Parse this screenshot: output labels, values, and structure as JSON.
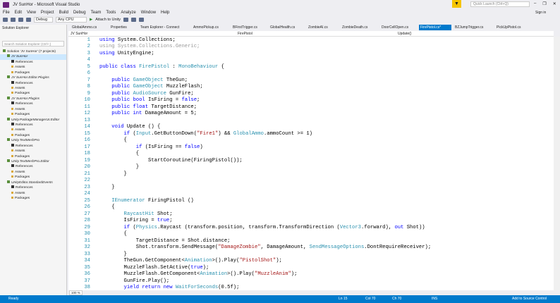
{
  "title": "JV SunHor - Microsoft Visual Studio",
  "menu": [
    "File",
    "Edit",
    "View",
    "Project",
    "Build",
    "Debug",
    "Team",
    "Tools",
    "Analyze",
    "Window",
    "Help"
  ],
  "toolbar": {
    "config": "Debug",
    "platform": "Any CPU",
    "attach": "Attach to Unity"
  },
  "quick_launch": "Quick Launch (Ctrl+Q)",
  "sign_in": "Sign in",
  "solution_explorer": {
    "title": "Solution Explorer",
    "search_placeholder": "Search Solution Explorer (Ctrl+;)",
    "items": [
      {
        "label": "Solution 'JV SunHor' (7 projects)",
        "level": 0,
        "type": "solution"
      },
      {
        "label": "JV SunHor",
        "level": 1,
        "type": "project",
        "selected": true
      },
      {
        "label": "References",
        "level": 2,
        "type": "ref"
      },
      {
        "label": "Assets",
        "level": 2,
        "type": "folder"
      },
      {
        "label": "Packages",
        "level": 2,
        "type": "folder"
      },
      {
        "label": "JV SunHor.Editor.Plugins",
        "level": 1,
        "type": "project"
      },
      {
        "label": "References",
        "level": 2,
        "type": "ref"
      },
      {
        "label": "Assets",
        "level": 2,
        "type": "folder"
      },
      {
        "label": "Packages",
        "level": 2,
        "type": "folder"
      },
      {
        "label": "JV SunHor.Plugins",
        "level": 1,
        "type": "project"
      },
      {
        "label": "References",
        "level": 2,
        "type": "ref"
      },
      {
        "label": "Assets",
        "level": 2,
        "type": "folder"
      },
      {
        "label": "Packages",
        "level": 2,
        "type": "folder"
      },
      {
        "label": "Unity.PackageManagerUI.Editor",
        "level": 1,
        "type": "project"
      },
      {
        "label": "References",
        "level": 2,
        "type": "ref"
      },
      {
        "label": "Assets",
        "level": 2,
        "type": "folder"
      },
      {
        "label": "Packages",
        "level": 2,
        "type": "folder"
      },
      {
        "label": "Unity.TextMeshPro",
        "level": 1,
        "type": "project"
      },
      {
        "label": "References",
        "level": 2,
        "type": "ref"
      },
      {
        "label": "Assets",
        "level": 2,
        "type": "folder"
      },
      {
        "label": "Packages",
        "level": 2,
        "type": "folder"
      },
      {
        "label": "Unity.TextMeshPro.Editor",
        "level": 1,
        "type": "project"
      },
      {
        "label": "References",
        "level": 2,
        "type": "ref"
      },
      {
        "label": "Assets",
        "level": 2,
        "type": "folder"
      },
      {
        "label": "Packages",
        "level": 2,
        "type": "folder"
      },
      {
        "label": "UnityEditor.StandardEvents",
        "level": 1,
        "type": "project"
      },
      {
        "label": "References",
        "level": 2,
        "type": "ref"
      },
      {
        "label": "Assets",
        "level": 2,
        "type": "folder"
      },
      {
        "label": "Packages",
        "level": 2,
        "type": "folder"
      }
    ]
  },
  "tabs": [
    {
      "label": "GlobalAmmo.cs"
    },
    {
      "label": "Properties"
    },
    {
      "label": "Team Explorer - Connect"
    },
    {
      "label": "AmmoPickup.cs"
    },
    {
      "label": "BFirstTrigger.cs"
    },
    {
      "label": "GlobalHealth.cs"
    },
    {
      "label": "ZombieAI.cs"
    },
    {
      "label": "ZombieDeath.cs"
    },
    {
      "label": "DoorCellOpen.cs"
    },
    {
      "label": "FirePistol.cs*",
      "active": true
    },
    {
      "label": "BZJumpTrigger.cs"
    },
    {
      "label": "PickUpPistol.cs"
    }
  ],
  "navbar": {
    "project": "JV SunHor",
    "class": "FirePistol",
    "member": "Update()"
  },
  "code": [
    [
      [
        "using",
        "k"
      ],
      [
        " System.Collections;",
        "p"
      ]
    ],
    [
      [
        "using System.Collections.Generic;",
        "g"
      ]
    ],
    [
      [
        "using",
        "k"
      ],
      [
        " UnityEngine;",
        "p"
      ]
    ],
    [],
    [
      [
        "public class ",
        "k"
      ],
      [
        "FirePistol",
        "t"
      ],
      [
        " : ",
        "p"
      ],
      [
        "MonoBehaviour",
        "t"
      ],
      [
        " {",
        "p"
      ]
    ],
    [],
    [
      [
        "    public ",
        "k"
      ],
      [
        "GameObject",
        "t"
      ],
      [
        " TheGun;",
        "p"
      ]
    ],
    [
      [
        "    public ",
        "k"
      ],
      [
        "GameObject",
        "t"
      ],
      [
        " MuzzleFlash;",
        "p"
      ]
    ],
    [
      [
        "    public ",
        "k"
      ],
      [
        "AudioSource",
        "t"
      ],
      [
        " GunFire;",
        "p"
      ]
    ],
    [
      [
        "    public bool",
        "k"
      ],
      [
        " IsFiring = ",
        "p"
      ],
      [
        "false",
        "k"
      ],
      [
        ";",
        "p"
      ]
    ],
    [
      [
        "    public float",
        "k"
      ],
      [
        " TargetDistance;",
        "p"
      ]
    ],
    [
      [
        "    public int",
        "k"
      ],
      [
        " DamageAmount = 5;",
        "p"
      ]
    ],
    [],
    [
      [
        "    void",
        "k"
      ],
      [
        " Update () {",
        "p"
      ]
    ],
    [
      [
        "        if",
        "k"
      ],
      [
        " (",
        "p"
      ],
      [
        "Input",
        "t"
      ],
      [
        ".GetButtonDown(",
        "p"
      ],
      [
        "\"Fire1\"",
        "s"
      ],
      [
        ") && ",
        "p"
      ],
      [
        "GlobalAmmo",
        "t"
      ],
      [
        ".ammoCount >= 1)",
        "p"
      ]
    ],
    [
      [
        "        {",
        "p"
      ]
    ],
    [
      [
        "            if",
        "k"
      ],
      [
        " (IsFiring == ",
        "p"
      ],
      [
        "false",
        "k"
      ],
      [
        ")",
        "p"
      ]
    ],
    [
      [
        "            {",
        "p"
      ]
    ],
    [
      [
        "                StartCoroutine(FiringPistol());",
        "p"
      ]
    ],
    [
      [
        "            }",
        "p"
      ]
    ],
    [
      [
        "        }",
        "p"
      ]
    ],
    [],
    [
      [
        "    }",
        "p"
      ]
    ],
    [],
    [
      [
        "    ",
        "p"
      ],
      [
        "IEnumerator",
        "t"
      ],
      [
        " FiringPistol ()",
        "p"
      ]
    ],
    [
      [
        "    {",
        "p"
      ]
    ],
    [
      [
        "        ",
        "p"
      ],
      [
        "RaycastHit",
        "t"
      ],
      [
        " Shot;",
        "p"
      ]
    ],
    [
      [
        "        IsFiring = ",
        "p"
      ],
      [
        "true",
        "k"
      ],
      [
        ";",
        "p"
      ]
    ],
    [
      [
        "        if",
        "k"
      ],
      [
        " (",
        "p"
      ],
      [
        "Physics",
        "t"
      ],
      [
        ".Raycast (transform.position, transform.TransformDirection (",
        "p"
      ],
      [
        "Vector3",
        "t"
      ],
      [
        ".forward), ",
        "p"
      ],
      [
        "out",
        "k"
      ],
      [
        " Shot))",
        "p"
      ]
    ],
    [
      [
        "        {",
        "p"
      ]
    ],
    [
      [
        "            TargetDistance = Shot.distance;",
        "p"
      ]
    ],
    [
      [
        "            Shot.transform.SendMessage(",
        "p"
      ],
      [
        "\"DamageZombie\"",
        "s"
      ],
      [
        ", DamageAmount, ",
        "p"
      ],
      [
        "SendMessageOptions",
        "t"
      ],
      [
        ".DontRequireReceiver);",
        "p"
      ]
    ],
    [
      [
        "        }",
        "p"
      ]
    ],
    [
      [
        "        TheGun.GetComponent<",
        "p"
      ],
      [
        "Animation",
        "t"
      ],
      [
        ">().Play(",
        "p"
      ],
      [
        "\"PistolShot\"",
        "s"
      ],
      [
        ");",
        "p"
      ]
    ],
    [
      [
        "        MuzzleFlash.SetActive(",
        "p"
      ],
      [
        "true",
        "k"
      ],
      [
        ");",
        "p"
      ]
    ],
    [
      [
        "        MuzzleFlash.GetComponent<",
        "p"
      ],
      [
        "Animation",
        "t"
      ],
      [
        ">().Play(",
        "p"
      ],
      [
        "\"MuzzleAnim\"",
        "s"
      ],
      [
        ");",
        "p"
      ]
    ],
    [
      [
        "        GunFire.Play();",
        "p"
      ]
    ],
    [
      [
        "        yield return new ",
        "k"
      ],
      [
        "WaitForSeconds",
        "t"
      ],
      [
        "(0.5f);",
        "p"
      ]
    ]
  ],
  "zoom": "100 %",
  "status": {
    "ready": "Ready",
    "ln": "Ln 15",
    "col": "Col 70",
    "ch": "Ch 70",
    "ins": "INS",
    "source_control": "Add to Source Control"
  },
  "colors": {
    "accent": "#007acc",
    "keyword": "#0000ff",
    "type": "#2b91af",
    "string": "#a31515"
  }
}
